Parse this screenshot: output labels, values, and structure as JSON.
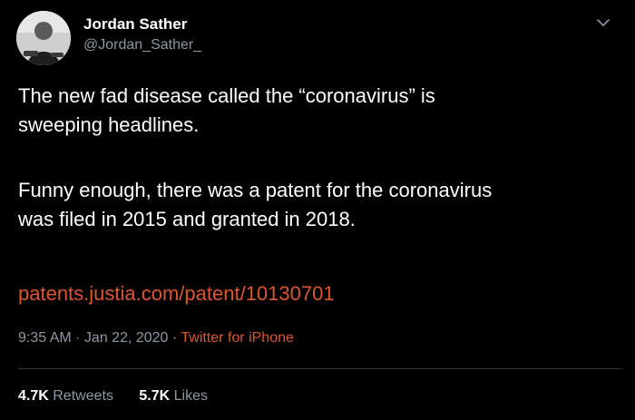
{
  "author": {
    "display_name": "Jordan Sather",
    "handle": "@Jordan_Sather_"
  },
  "tweet": {
    "paragraph_1_line_1": "The new fad disease called the “coronavirus” is",
    "paragraph_1_line_2": "sweeping headlines.",
    "paragraph_2_line_1": "Funny enough, there was a patent for the coronavirus",
    "paragraph_2_line_2": "was filed in 2015 and granted in 2018.",
    "link_text": "patents.justia.com/patent/10130701"
  },
  "meta": {
    "time": "9:35 AM",
    "separator_1": " · ",
    "date": "Jan 22, 2020",
    "separator_2": " · ",
    "source": "Twitter for iPhone"
  },
  "stats": {
    "retweets_count": "4.7K",
    "retweets_label": "Retweets",
    "likes_count": "5.7K",
    "likes_label": "Likes"
  },
  "icons": {
    "menu": "chevron-down-icon",
    "avatar": "avatar-photo"
  },
  "colors": {
    "background": "#000000",
    "primary_text": "#ffffff",
    "secondary_text": "#8b98a5",
    "link": "#e0542e",
    "divider": "#2f3336"
  }
}
